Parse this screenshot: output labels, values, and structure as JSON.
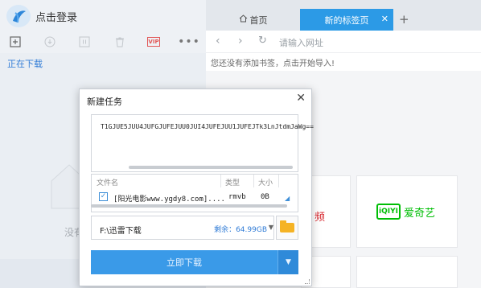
{
  "left": {
    "login_label": "点击登录",
    "toolbar_vip": "VIP",
    "downloading_label": "正在下载",
    "empty_text": "没有"
  },
  "browser": {
    "tabs": [
      {
        "label": "首页"
      },
      {
        "label": "新的标签页"
      }
    ],
    "url_placeholder": "请输入网址",
    "bookmark_hint": "您还没有添加书签，点击开始导入!",
    "tile_text": "频",
    "iqiyi_logo": "iQIYI",
    "iqiyi_text": "爱奇艺"
  },
  "dialog": {
    "title": "新建任务",
    "link_text": "T1GJUE5JUU4JUFGJUFEJUU0JUI4JUFEJUU1JUFEJTk3LnJtdmJaWg==",
    "table": {
      "headers": [
        "文件名",
        "类型",
        "大小"
      ],
      "row": {
        "name": "[阳光电影www.ygdy8.com]....",
        "type": "rmvb",
        "size": "0B"
      }
    },
    "save_path": "F:\\迅雷下载",
    "free_space": "剩余：64.99GB",
    "download_button": "立即下载"
  },
  "colors": {
    "accent": "#2c9ae6",
    "download_button": "#3a9ae8",
    "link_blue": "#2f7bd6",
    "iqiyi_green": "#00be06",
    "vip_red": "#e25757"
  }
}
